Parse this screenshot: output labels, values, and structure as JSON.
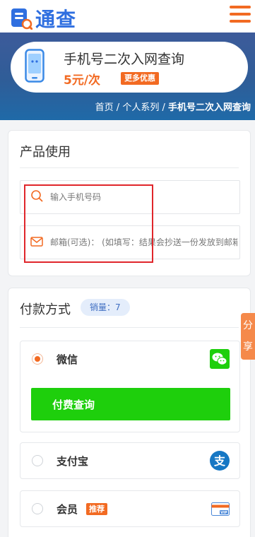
{
  "header": {
    "logo_text": "通查",
    "accent": "#2f6fe0",
    "menu_color": "#f26a22"
  },
  "product": {
    "title": "手机号二次入网查询",
    "price": "5元/次",
    "more_label": "更多优惠"
  },
  "breadcrumb": {
    "items": [
      "首页",
      "个人系列",
      "手机号二次入网查询"
    ],
    "separator": " / "
  },
  "usage": {
    "title": "产品使用",
    "phone_placeholder": "输入手机号码",
    "email_placeholder": "邮箱(可选)： (如填写：结果会抄送一份发放到邮箱)"
  },
  "payment": {
    "title": "付款方式",
    "sales_badge": "销量：7",
    "options": [
      {
        "label": "微信",
        "selected": true,
        "icon": "wechat-icon",
        "icon_color": "#1ecf0c"
      },
      {
        "label": "支付宝",
        "selected": false,
        "icon": "alipay-icon",
        "icon_color": "#1677c4"
      },
      {
        "label": "会员",
        "selected": false,
        "icon": "vip-card-icon",
        "badge": "推荐"
      }
    ],
    "pay_button": "付费查询",
    "pay_button_color": "#1ecf0c"
  },
  "share_tab": {
    "line1": "分",
    "line2": "享"
  }
}
